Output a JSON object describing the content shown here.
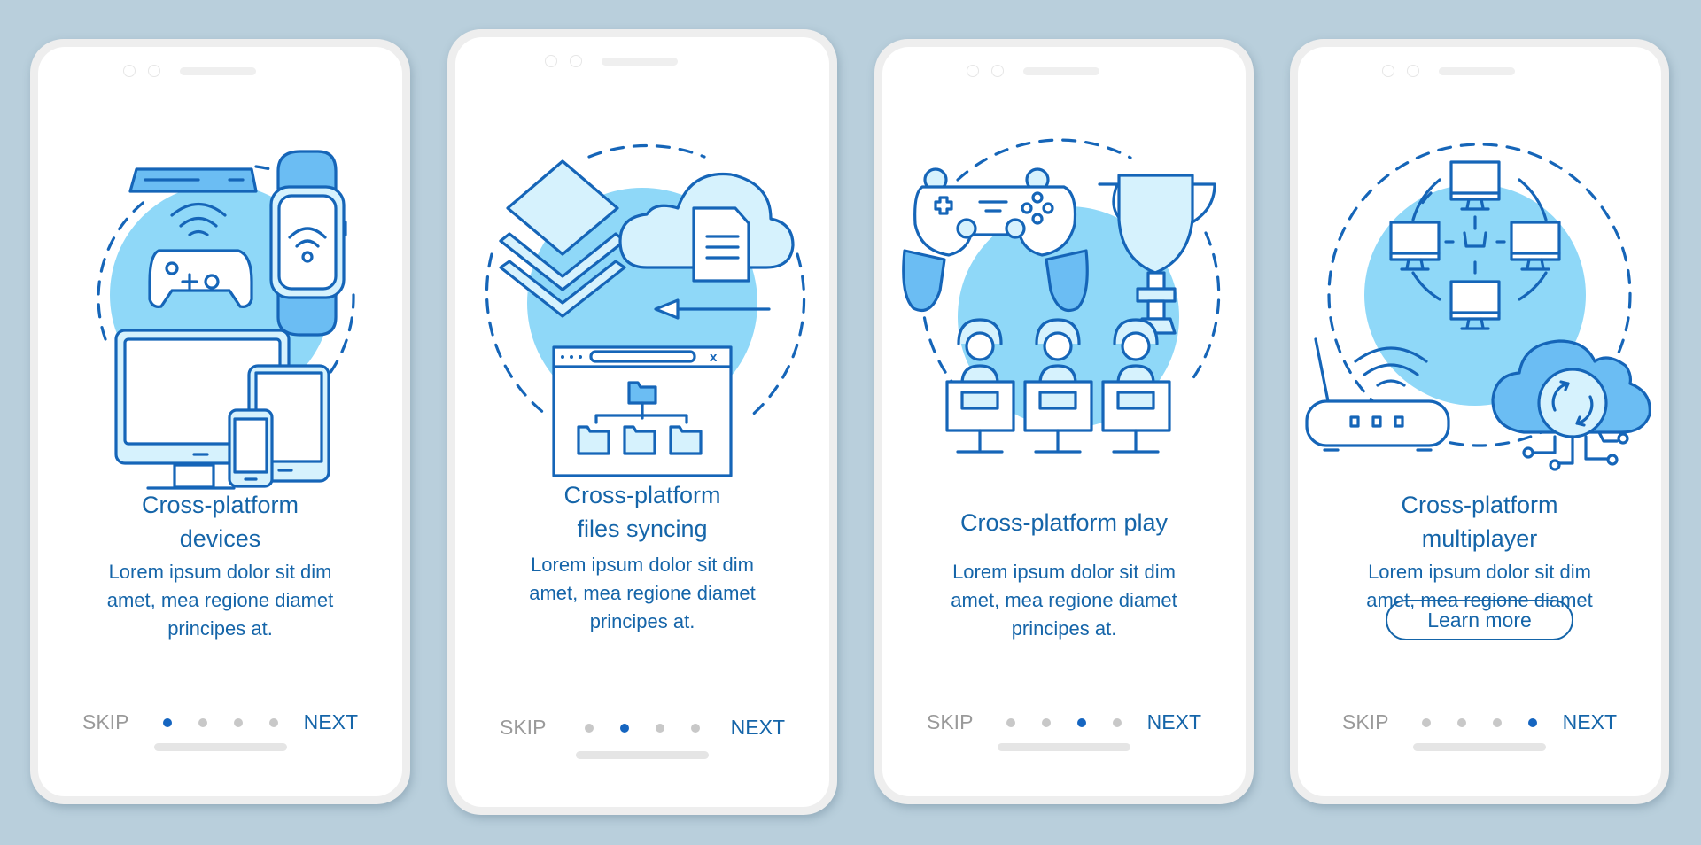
{
  "theme": {
    "background": "#b9cfdc",
    "accent": "#1565a9",
    "active_dot": "#1565c0",
    "inactive_dot": "#c8c8c8",
    "skip_color": "#9a9a9a",
    "illustration_fill": "#8fd8f8"
  },
  "screens": [
    {
      "title_lines": [
        "Cross-platform",
        "devices"
      ],
      "body_lines": [
        "Lorem ipsum dolor sit dim",
        "amet, mea regione diamet",
        "principes at."
      ],
      "illustration_icons": [
        "set-top-box-icon",
        "gamepad-icon",
        "wifi-icon",
        "smartwatch-icon",
        "monitor-icon",
        "tablet-icon",
        "smartphone-icon"
      ],
      "skip_label": "SKIP",
      "next_label": "NEXT",
      "page_index": 1,
      "page_count": 4
    },
    {
      "title_lines": [
        "Cross-platform",
        "files syncing"
      ],
      "body_lines": [
        "Lorem ipsum dolor sit dim",
        "amet, mea regione diamet",
        "principes at."
      ],
      "illustration_icons": [
        "layers-icon",
        "cloud-document-icon",
        "arrow-left-icon",
        "browser-folder-tree-icon"
      ],
      "browser_close_glyph": "x",
      "skip_label": "SKIP",
      "next_label": "NEXT",
      "page_index": 2,
      "page_count": 4
    },
    {
      "title_lines": [
        "Cross-platform play"
      ],
      "body_lines": [
        "Lorem ipsum dolor sit dim",
        "amet, mea regione diamet",
        "principes at."
      ],
      "illustration_icons": [
        "gamepad-icon",
        "trophy-icon",
        "gamer-icon",
        "gamer-icon",
        "gamer-icon"
      ],
      "skip_label": "SKIP",
      "next_label": "NEXT",
      "page_index": 3,
      "page_count": 4
    },
    {
      "title_lines": [
        "Cross-platform",
        "multiplayer"
      ],
      "body_lines": [
        "Lorem ipsum dolor sit dim",
        "amet, mea regione diamet"
      ],
      "illustration_icons": [
        "network-computers-icon",
        "router-icon",
        "cloud-sync-icon"
      ],
      "button_label": "Learn more",
      "skip_label": "SKIP",
      "next_label": "NEXT",
      "page_index": 4,
      "page_count": 4
    }
  ]
}
